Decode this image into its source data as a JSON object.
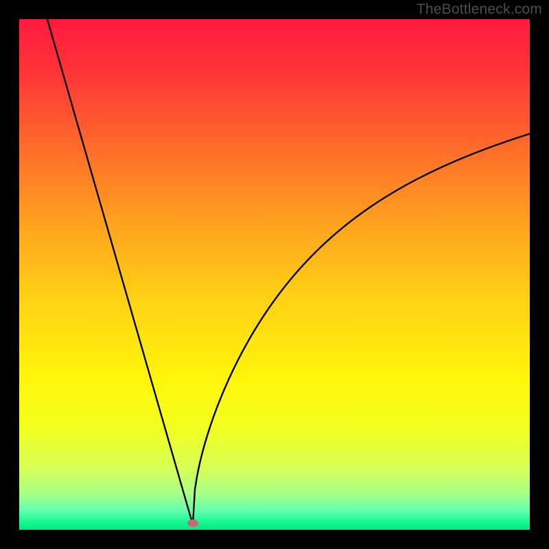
{
  "watermark": "TheBottleneck.com",
  "chart_data": {
    "type": "line",
    "title": "",
    "xlabel": "",
    "ylabel": "",
    "xlim": [
      0,
      1
    ],
    "ylim": [
      0,
      1
    ],
    "curve": {
      "min_x": 0.34,
      "min_y": 0.01,
      "left": {
        "start_x": 0.055,
        "start_y": 1.0
      },
      "right": {
        "end_x": 1.0,
        "end_y": 0.79
      }
    },
    "marker": {
      "x": 0.34,
      "y": 0.013,
      "color": "#bf6b74"
    },
    "gradient_stops": [
      {
        "offset": 0.0,
        "color": "#ff1a3f"
      },
      {
        "offset": 0.1,
        "color": "#ff3338"
      },
      {
        "offset": 0.25,
        "color": "#ff6b2a"
      },
      {
        "offset": 0.4,
        "color": "#ffa21f"
      },
      {
        "offset": 0.55,
        "color": "#ffd214"
      },
      {
        "offset": 0.7,
        "color": "#fff50a"
      },
      {
        "offset": 0.8,
        "color": "#f2ff1f"
      },
      {
        "offset": 0.88,
        "color": "#d6ff56"
      },
      {
        "offset": 0.93,
        "color": "#a8ff8a"
      },
      {
        "offset": 0.965,
        "color": "#5cffb0"
      },
      {
        "offset": 0.985,
        "color": "#17f793"
      },
      {
        "offset": 1.0,
        "color": "#00e876"
      }
    ]
  }
}
